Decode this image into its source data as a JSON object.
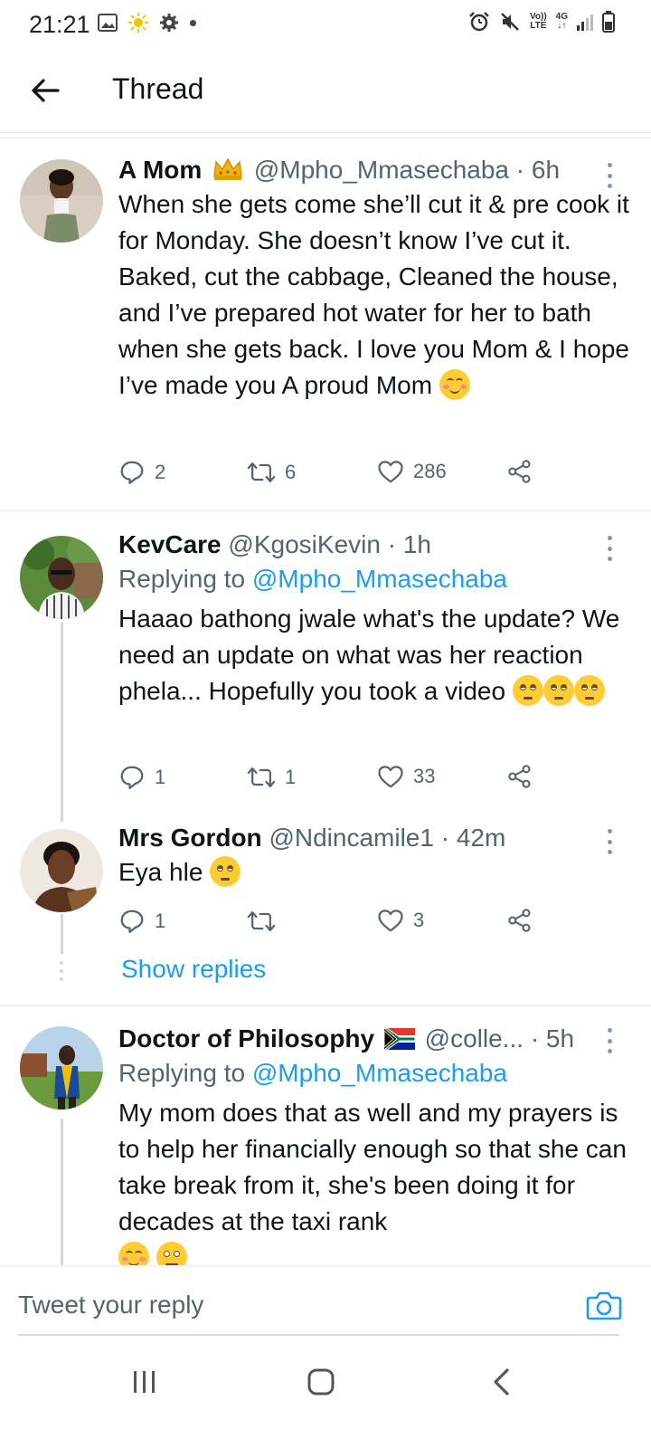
{
  "status_bar": {
    "time": "21:21",
    "network_top": "Vo))",
    "network_bottom": "LTE",
    "cell_top": "4G",
    "cell_bottom": "↓↑"
  },
  "header": {
    "title": "Thread"
  },
  "tweets": [
    {
      "name": "A Mom",
      "name_badge": "crown",
      "handle": "@Mpho_Mmasechaba",
      "separator": "·",
      "time": "6h",
      "text": "When she gets come she’ll cut it & pre cook it for Monday. She doesn’t know I’ve cut it. Baked, cut the cabbage, Cleaned the house, and I’ve prepared hot water for her to bath when she gets back. I love you Mom & I hope I’ve made you A proud Mom",
      "emoji": "smiling-face-with-blush",
      "replies": "2",
      "retweets": "6",
      "likes": "286"
    },
    {
      "name": "KevCare",
      "handle": "@KgosiKevin",
      "separator": "·",
      "time": "1h",
      "replying_prefix": "Replying to",
      "replying_to": "@Mpho_Mmasechaba",
      "text": "Haaao bathong jwale what's the update? We need an update on what was her reaction phela... Hopefully you took a video",
      "emoji": "face-with-rolling-eyes",
      "replies": "1",
      "retweets": "1",
      "likes": "33"
    },
    {
      "name": "Mrs Gordon",
      "handle": "@Ndincamile1",
      "separator": "·",
      "time": "42m",
      "text": "Eya hle",
      "emoji": "face-with-rolling-eyes",
      "replies": "1",
      "retweets": "",
      "likes": "3",
      "show_replies": "Show replies"
    },
    {
      "name": "Doctor of Philosophy",
      "name_badge": "south-africa-flag",
      "handle": "@colle...",
      "separator": "·",
      "time": "5h",
      "replying_prefix": "Replying to",
      "replying_to": "@Mpho_Mmasechaba",
      "text": "My mom does that as well and my prayers is to help her financially enough so that she can take break from it, she's been doing it for decades at the taxi rank"
    }
  ],
  "composer": {
    "placeholder": "Tweet your reply"
  },
  "colors": {
    "accent": "#1d9bf0",
    "muted": "#536471",
    "text": "#0f1419"
  }
}
